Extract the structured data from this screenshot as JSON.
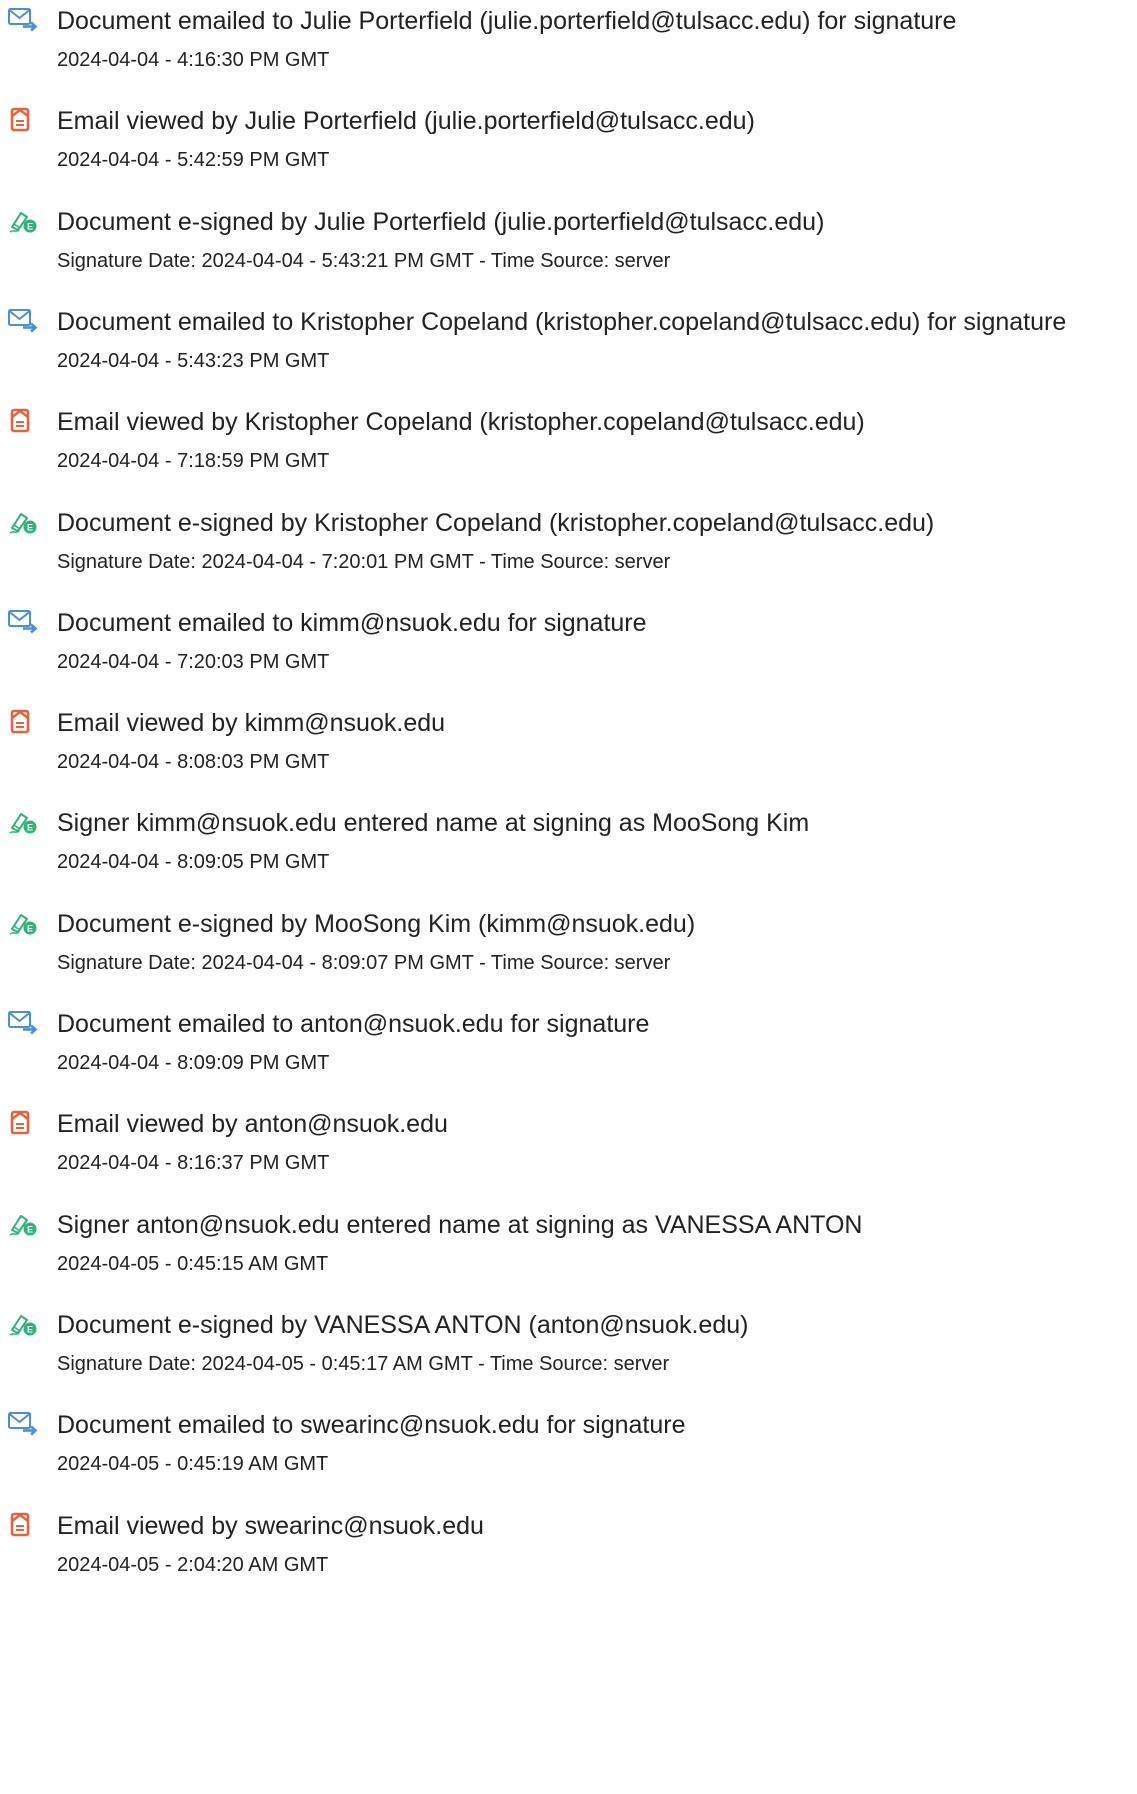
{
  "colors": {
    "email_icon": "#4a90d9",
    "view_icon": "#e8613a",
    "sign_icon": "#2bb673",
    "text": "#222222"
  },
  "events": [
    {
      "icon": "email-sent-icon",
      "title": "Document emailed to Julie Porterfield (julie.porterfield@tulsacc.edu) for signature",
      "detail": "2024-04-04 - 4:16:30 PM GMT"
    },
    {
      "icon": "email-viewed-icon",
      "title": "Email viewed by Julie Porterfield (julie.porterfield@tulsacc.edu)",
      "detail": "2024-04-04 - 5:42:59 PM GMT"
    },
    {
      "icon": "e-sign-icon",
      "title": "Document e-signed by Julie Porterfield (julie.porterfield@tulsacc.edu)",
      "detail": "Signature Date: 2024-04-04 - 5:43:21 PM GMT - Time Source: server"
    },
    {
      "icon": "email-sent-icon",
      "title": "Document emailed to Kristopher Copeland (kristopher.copeland@tulsacc.edu) for signature",
      "detail": "2024-04-04 - 5:43:23 PM GMT"
    },
    {
      "icon": "email-viewed-icon",
      "title": "Email viewed by Kristopher Copeland (kristopher.copeland@tulsacc.edu)",
      "detail": "2024-04-04 - 7:18:59 PM GMT"
    },
    {
      "icon": "e-sign-icon",
      "title": "Document e-signed by Kristopher Copeland (kristopher.copeland@tulsacc.edu)",
      "detail": "Signature Date: 2024-04-04 - 7:20:01 PM GMT - Time Source: server"
    },
    {
      "icon": "email-sent-icon",
      "title": "Document emailed to kimm@nsuok.edu for signature",
      "detail": "2024-04-04 - 7:20:03 PM GMT"
    },
    {
      "icon": "email-viewed-icon",
      "title": "Email viewed by kimm@nsuok.edu",
      "detail": "2024-04-04 - 8:08:03 PM GMT"
    },
    {
      "icon": "e-sign-icon",
      "title": "Signer kimm@nsuok.edu entered name at signing as MooSong Kim",
      "detail": "2024-04-04 - 8:09:05 PM GMT"
    },
    {
      "icon": "e-sign-icon",
      "title": "Document e-signed by MooSong Kim (kimm@nsuok.edu)",
      "detail": "Signature Date: 2024-04-04 - 8:09:07 PM GMT - Time Source: server"
    },
    {
      "icon": "email-sent-icon",
      "title": "Document emailed to anton@nsuok.edu for signature",
      "detail": "2024-04-04 - 8:09:09 PM GMT"
    },
    {
      "icon": "email-viewed-icon",
      "title": "Email viewed by anton@nsuok.edu",
      "detail": "2024-04-04 - 8:16:37 PM GMT"
    },
    {
      "icon": "e-sign-icon",
      "title": "Signer anton@nsuok.edu entered name at signing as VANESSA ANTON",
      "detail": "2024-04-05 - 0:45:15 AM GMT"
    },
    {
      "icon": "e-sign-icon",
      "title": "Document e-signed by VANESSA ANTON (anton@nsuok.edu)",
      "detail": "Signature Date: 2024-04-05 - 0:45:17 AM GMT - Time Source: server"
    },
    {
      "icon": "email-sent-icon",
      "title": "Document emailed to swearinc@nsuok.edu for signature",
      "detail": "2024-04-05 - 0:45:19 AM GMT"
    },
    {
      "icon": "email-viewed-icon",
      "title": "Email viewed by swearinc@nsuok.edu",
      "detail": "2024-04-05 - 2:04:20 AM GMT"
    }
  ]
}
